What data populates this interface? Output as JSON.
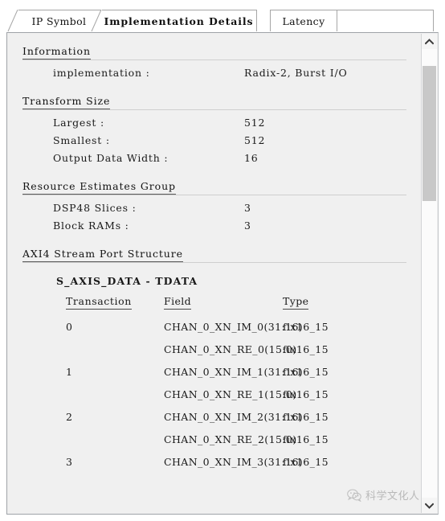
{
  "window": {
    "background_color": "#f0f0f0",
    "panel_border_color": "#9fa3a8"
  },
  "tabs": [
    {
      "id": "ip-symbol",
      "label": "IP Symbol",
      "active": false
    },
    {
      "id": "implementation-details",
      "label": "Implementation Details",
      "active": true
    },
    {
      "id": "latency",
      "label": "Latency",
      "active": false
    }
  ],
  "sections": [
    {
      "id": "information",
      "title": "Information",
      "rows": [
        {
          "key": "implementation :",
          "value": "Radix-2, Burst I/O"
        }
      ]
    },
    {
      "id": "transform-size",
      "title": "Transform Size",
      "rows": [
        {
          "key": "Largest :",
          "value": "512"
        },
        {
          "key": "Smallest :",
          "value": "512"
        },
        {
          "key": "Output Data Width :",
          "value": "16"
        }
      ]
    },
    {
      "id": "resource-estimates-group",
      "title": "Resource Estimates Group",
      "rows": [
        {
          "key": "DSP48 Slices :",
          "value": "3"
        },
        {
          "key": "Block RAMs :",
          "value": "3"
        }
      ]
    },
    {
      "id": "axi4-stream-port-structure",
      "title": "AXI4 Stream Port Structure",
      "rows": []
    }
  ],
  "axi_table": {
    "subheading": "S_AXIS_DATA - TDATA",
    "columns": [
      "Transaction",
      "Field",
      "Type"
    ],
    "rows": [
      {
        "transaction": "0",
        "field": "CHAN_0_XN_IM_0(31:16)",
        "type": "fix16_15"
      },
      {
        "transaction": "",
        "field": "CHAN_0_XN_RE_0(15:0)",
        "type": "fix16_15"
      },
      {
        "transaction": "1",
        "field": "CHAN_0_XN_IM_1(31:16)",
        "type": "fix16_15"
      },
      {
        "transaction": "",
        "field": "CHAN_0_XN_RE_1(15:0)",
        "type": "fix16_15"
      },
      {
        "transaction": "2",
        "field": "CHAN_0_XN_IM_2(31:16)",
        "type": "fix16_15"
      },
      {
        "transaction": "",
        "field": "CHAN_0_XN_RE_2(15:0)",
        "type": "fix16_15"
      },
      {
        "transaction": "3",
        "field": "CHAN_0_XN_IM_3(31:16)",
        "type": "fix16_15"
      }
    ]
  },
  "scrollbar": {
    "up_arrow": "chevron-up-icon",
    "down_arrow": "chevron-down-icon",
    "thumb_color": "#c8c8c8"
  },
  "watermark": {
    "text": "科学文化人",
    "logo": "wechat-icon"
  }
}
